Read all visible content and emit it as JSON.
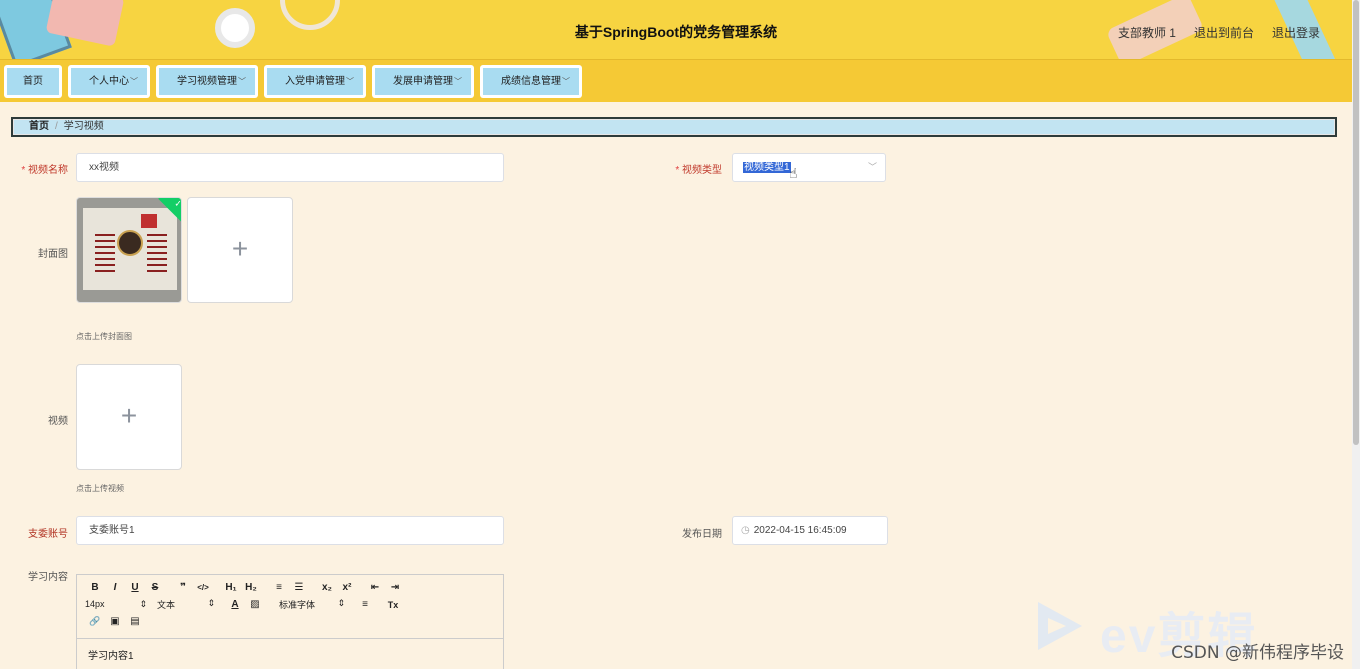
{
  "header": {
    "title": "基于SpringBoot的党务管理系统",
    "links": [
      "支部教师 1",
      "退出到前台",
      "退出登录"
    ]
  },
  "nav": {
    "items": [
      {
        "label": "首页",
        "has_dropdown": false
      },
      {
        "label": "个人中心",
        "has_dropdown": true
      },
      {
        "label": "学习视频管理",
        "has_dropdown": true
      },
      {
        "label": "入党申请管理",
        "has_dropdown": true
      },
      {
        "label": "发展申请管理",
        "has_dropdown": true
      },
      {
        "label": "成绩信息管理",
        "has_dropdown": true
      }
    ]
  },
  "breadcrumb": {
    "home": "首页",
    "current": "学习视频",
    "separator": "/"
  },
  "form": {
    "video_name": {
      "label": "视频名称",
      "value": "xx视频"
    },
    "video_type": {
      "label": "视频类型",
      "value": "视频类型1"
    },
    "cover": {
      "label": "封面图",
      "hint": "点击上传封面图",
      "plus": "+"
    },
    "video": {
      "label": "视频",
      "hint": "点击上传视频",
      "plus": "+"
    },
    "branch_account": {
      "label": "支委账号",
      "value": "支委账号1"
    },
    "publish_date": {
      "label": "发布日期",
      "value": "2022-04-15 16:45:09"
    },
    "content": {
      "label": "学习内容",
      "value": "学习内容1"
    }
  },
  "editor": {
    "row1": [
      "B",
      "I",
      "U",
      "S",
      "❞",
      "</>",
      "H₁",
      "H₂",
      "≡",
      "☰",
      "x₂",
      "x²",
      "⇤",
      "⇥"
    ],
    "font_size": "14px",
    "text_style": "文本",
    "font_family": "标准字体",
    "row2_icons": [
      "A",
      "▨",
      "≡",
      "Tx"
    ],
    "row3_icons": [
      "🔗",
      "▣",
      "▤"
    ]
  },
  "watermark": {
    "text": "CSDN @新伟程序毕设",
    "brand": "ev剪辑"
  },
  "colors": {
    "header_bg": "#f7d441",
    "nav_item_bg": "#a9dcf1",
    "page_bg": "#fcf2e1",
    "required": "#e04040"
  }
}
